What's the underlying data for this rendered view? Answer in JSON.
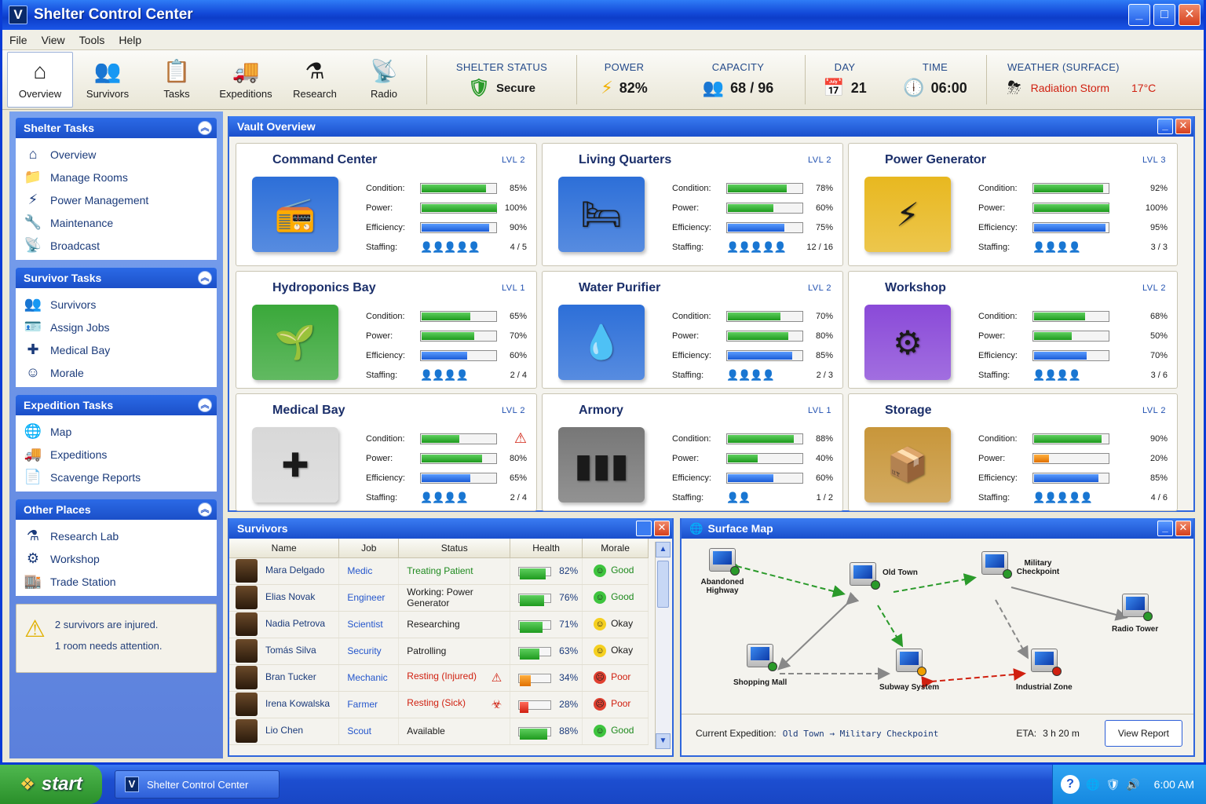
{
  "window": {
    "title": "Shelter Control Center",
    "icon_letter": "V"
  },
  "menu": [
    "File",
    "View",
    "Tools",
    "Help"
  ],
  "toolbar": [
    {
      "label": "Overview",
      "icon": "home-icon",
      "glyph": "⌂"
    },
    {
      "label": "Survivors",
      "icon": "people-icon",
      "glyph": "👥"
    },
    {
      "label": "Tasks",
      "icon": "clipboard-icon",
      "glyph": "📋"
    },
    {
      "label": "Expeditions",
      "icon": "truck-icon",
      "glyph": "🚚"
    },
    {
      "label": "Research",
      "icon": "flask-icon",
      "glyph": "⚗"
    },
    {
      "label": "Radio",
      "icon": "radio-tower-icon",
      "glyph": "📡"
    }
  ],
  "status": {
    "shelter_label": "SHELTER STATUS",
    "shelter_value": "Secure",
    "power_label": "POWER",
    "power_value": "82%",
    "capacity_label": "CAPACITY",
    "capacity_value": "68 / 96",
    "day_label": "DAY",
    "day_value": "21",
    "time_label": "TIME",
    "time_value": "06:00",
    "weather_label": "WEATHER (SURFACE)",
    "weather_value": "Radiation Storm",
    "weather_temp": "17°C"
  },
  "sidebar": {
    "shelter_tasks": {
      "title": "Shelter Tasks",
      "items": [
        "Overview",
        "Manage Rooms",
        "Power Management",
        "Maintenance",
        "Broadcast"
      ]
    },
    "survivor_tasks": {
      "title": "Survivor Tasks",
      "items": [
        "Survivors",
        "Assign Jobs",
        "Medical Bay",
        "Morale"
      ]
    },
    "expedition_tasks": {
      "title": "Expedition Tasks",
      "items": [
        "Map",
        "Expeditions",
        "Scavenge Reports"
      ]
    },
    "other_places": {
      "title": "Other Places",
      "items": [
        "Research Lab",
        "Workshop",
        "Trade Station"
      ]
    },
    "alert": {
      "line1": "2 survivors are injured.",
      "line2": "1 room needs attention."
    }
  },
  "vault": {
    "title": "Vault Overview",
    "labels": {
      "condition": "Condition:",
      "power": "Power:",
      "efficiency": "Efficiency:",
      "staffing": "Staffing:"
    },
    "rooms": [
      {
        "name": "Command Center",
        "lvl": "LVL  2",
        "condition": "85%",
        "power": "100%",
        "efficiency": "90%",
        "staff": "4 / 5",
        "c": 0.85,
        "p": 1.0,
        "e": 0.9,
        "sf": 4,
        "st": 5,
        "color": "#2d6fd8",
        "glyph": "📻",
        "alert": false
      },
      {
        "name": "Living Quarters",
        "lvl": "LVL  2",
        "condition": "78%",
        "power": "60%",
        "efficiency": "75%",
        "staff": "12 / 16",
        "c": 0.78,
        "p": 0.6,
        "e": 0.75,
        "sf": 5,
        "st": 5,
        "color": "#2d6fd8",
        "glyph": "🛏",
        "alert": false
      },
      {
        "name": "Power Generator",
        "lvl": "LVL  3",
        "condition": "92%",
        "power": "100%",
        "efficiency": "95%",
        "staff": "3 / 3",
        "c": 0.92,
        "p": 1.0,
        "e": 0.95,
        "sf": 4,
        "st": 4,
        "color": "#e8b820",
        "glyph": "⚡",
        "alert": false
      },
      {
        "name": "Hydroponics Bay",
        "lvl": "LVL  1",
        "condition": "65%",
        "power": "70%",
        "efficiency": "60%",
        "staff": "2 / 4",
        "c": 0.65,
        "p": 0.7,
        "e": 0.6,
        "sf": 3,
        "st": 4,
        "color": "#3aa83a",
        "glyph": "🌱",
        "alert": false
      },
      {
        "name": "Water Purifier",
        "lvl": "LVL  2",
        "condition": "70%",
        "power": "80%",
        "efficiency": "85%",
        "staff": "2 / 3",
        "c": 0.7,
        "p": 0.8,
        "e": 0.85,
        "sf": 3,
        "st": 4,
        "color": "#2d6fd8",
        "glyph": "💧",
        "alert": false
      },
      {
        "name": "Workshop",
        "lvl": "LVL  2",
        "condition": "68%",
        "power": "50%",
        "efficiency": "70%",
        "staff": "3 / 6",
        "c": 0.68,
        "p": 0.5,
        "e": 0.7,
        "sf": 3,
        "st": 4,
        "color": "#8a4ad8",
        "glyph": "⚙",
        "alert": false
      },
      {
        "name": "Medical Bay",
        "lvl": "LVL  2",
        "condition": "",
        "power": "80%",
        "efficiency": "65%",
        "staff": "2 / 4",
        "c": 0.5,
        "p": 0.8,
        "e": 0.65,
        "sf": 3,
        "st": 4,
        "color": "#d8d8d8",
        "glyph": "✚",
        "alert": true
      },
      {
        "name": "Armory",
        "lvl": "LVL  1",
        "condition": "88%",
        "power": "40%",
        "efficiency": "60%",
        "staff": "1 / 2",
        "c": 0.88,
        "p": 0.4,
        "e": 0.6,
        "sf": 2,
        "st": 2,
        "color": "#777777",
        "glyph": "▮▮▮",
        "alert": false
      },
      {
        "name": "Storage",
        "lvl": "LVL  2",
        "condition": "90%",
        "power": "20%",
        "efficiency": "85%",
        "staff": "4 / 6",
        "c": 0.9,
        "p": 0.2,
        "e": 0.85,
        "sf": 4,
        "st": 5,
        "color": "#c8963a",
        "glyph": "📦",
        "alert": false
      }
    ]
  },
  "survivors": {
    "title": "Survivors",
    "headers": [
      "Name",
      "Job",
      "Status",
      "Health",
      "Morale"
    ],
    "rows": [
      {
        "name": "Mara Delgado",
        "job": "Medic",
        "status": "Treating Patient",
        "status_color": "#1f8a1f",
        "health": "82%",
        "h": 0.82,
        "morale": "Good",
        "mood": "good",
        "flag": ""
      },
      {
        "name": "Elias Novak",
        "job": "Engineer",
        "status": "Working: Power Generator",
        "status_color": "#1a1a1a",
        "health": "76%",
        "h": 0.76,
        "morale": "Good",
        "mood": "good",
        "flag": ""
      },
      {
        "name": "Nadia Petrova",
        "job": "Scientist",
        "status": "Researching",
        "status_color": "#1a1a1a",
        "health": "71%",
        "h": 0.71,
        "morale": "Okay",
        "mood": "okay",
        "flag": ""
      },
      {
        "name": "Tomás Silva",
        "job": "Security",
        "status": "Patrolling",
        "status_color": "#1a1a1a",
        "health": "63%",
        "h": 0.63,
        "morale": "Okay",
        "mood": "okay",
        "flag": ""
      },
      {
        "name": "Bran Tucker",
        "job": "Mechanic",
        "status": "Resting (Injured)",
        "status_color": "#d02010",
        "health": "34%",
        "h": 0.34,
        "morale": "Poor",
        "mood": "poor",
        "flag": "⚠"
      },
      {
        "name": "Irena Kowalska",
        "job": "Farmer",
        "status": "Resting (Sick)",
        "status_color": "#d02010",
        "health": "28%",
        "h": 0.28,
        "morale": "Poor",
        "mood": "poor",
        "flag": "☣"
      },
      {
        "name": "Lio Chen",
        "job": "Scout",
        "status": "Available",
        "status_color": "#1a1a1a",
        "health": "88%",
        "h": 0.88,
        "morale": "Good",
        "mood": "good",
        "flag": ""
      }
    ]
  },
  "map": {
    "title": "Surface Map",
    "nodes": [
      "Abandoned Highway",
      "Old Town",
      "Military Checkpoint",
      "Radio Tower",
      "Shopping Mall",
      "Subway System",
      "Industrial Zone"
    ],
    "expedition_label": "Current Expedition:",
    "expedition_route": "Old Town → Military Checkpoint",
    "eta_label": "ETA:",
    "eta_value": "3 h 20 m",
    "report_button": "View Report"
  },
  "taskbar": {
    "start": "start",
    "task": "Shelter Control Center",
    "clock": "6:00 AM"
  },
  "colors": {
    "accent": "#1a4fcc",
    "good": "#1f8a1f",
    "bad": "#d02010",
    "warn": "#e07000"
  }
}
